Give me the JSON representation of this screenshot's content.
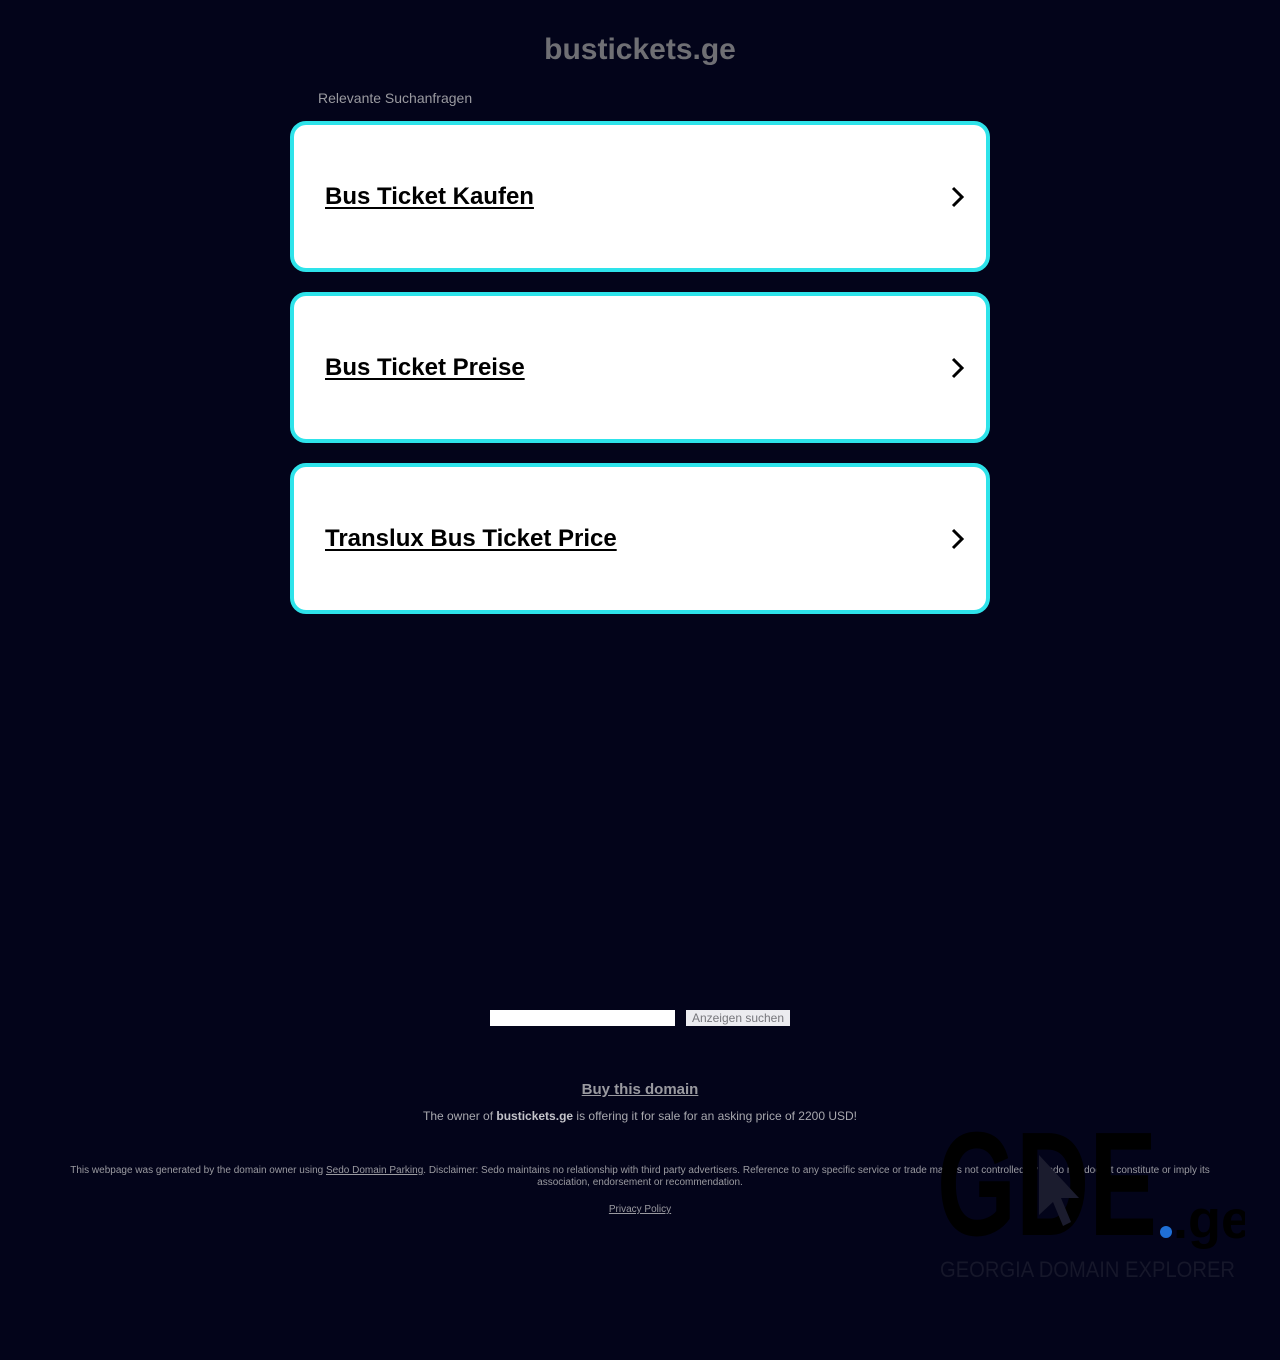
{
  "header": {
    "title": "bustickets.ge",
    "related_label": "Relevante Suchanfragen"
  },
  "ads": [
    {
      "label": "Bus Ticket Kaufen"
    },
    {
      "label": "Bus Ticket Preise"
    },
    {
      "label": "Translux Bus Ticket Price"
    }
  ],
  "search": {
    "value": "",
    "button_label": "Anzeigen suchen"
  },
  "sale": {
    "buy_label": "Buy this domain",
    "prefix": "The owner of ",
    "domain": "bustickets.ge",
    "suffix": " is offering it for sale for an asking price of 2200 USD!"
  },
  "footer": {
    "disclaimer_prefix": "This webpage was generated by the domain owner using ",
    "disclaimer_link": "Sedo Domain Parking",
    "disclaimer_suffix": ". Disclaimer: Sedo maintains no relationship with third party advertisers. Reference to any specific service or trade mark is not controlled by Sedo nor does it constitute or imply its association, endorsement or recommendation.",
    "privacy_label": "Privacy Policy"
  },
  "logo": {
    "wordmark": "GDE",
    "suffix": ".ge",
    "tagline": "GEORGIA DOMAIN EXPLORER"
  },
  "colors": {
    "background": "#03041a",
    "card_border": "#2ee3ea",
    "logo_dot": "#1f6fd6"
  }
}
